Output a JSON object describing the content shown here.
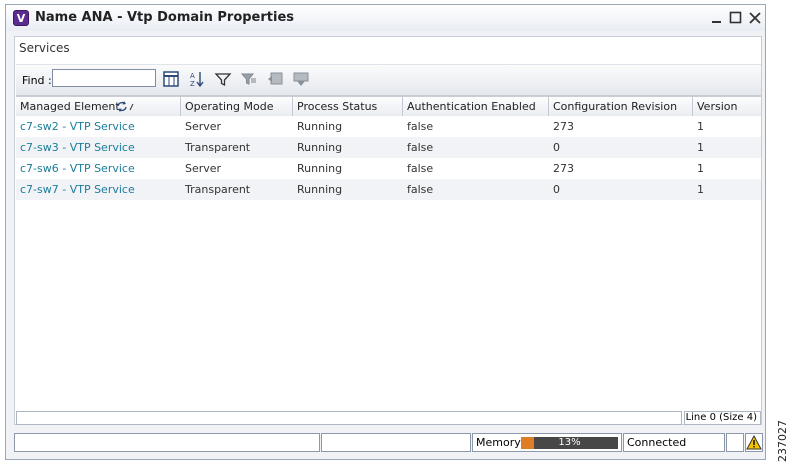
{
  "window": {
    "title": "Name ANA - Vtp Domain Properties",
    "icon_letter": "V"
  },
  "panel": {
    "label": "Services"
  },
  "toolbar": {
    "find_label": "Find :",
    "find_value": ""
  },
  "grid": {
    "columns": [
      "Managed Element",
      "Operating Mode",
      "Process Status",
      "Authentication Enabled",
      "Configuration Revision",
      "Version"
    ],
    "rows": [
      [
        "c7-sw2 - VTP Service",
        "Server",
        "Running",
        "false",
        "273",
        "1"
      ],
      [
        "c7-sw3 - VTP Service",
        "Transparent",
        "Running",
        "false",
        "0",
        "1"
      ],
      [
        "c7-sw6 - VTP Service",
        "Server",
        "Running",
        "false",
        "273",
        "1"
      ],
      [
        "c7-sw7 - VTP Service",
        "Transparent",
        "Running",
        "false",
        "0",
        "1"
      ]
    ],
    "line_info": "Line 0 (Size 4)"
  },
  "statusbar": {
    "memory_label": "Memory:",
    "memory_percent": 13,
    "memory_text": "13%",
    "connection": "Connected"
  },
  "side_mark": "237027",
  "colors": {
    "link": "#1a7d9a",
    "memory_fill": "#e07b26",
    "memory_track": "#474747"
  }
}
